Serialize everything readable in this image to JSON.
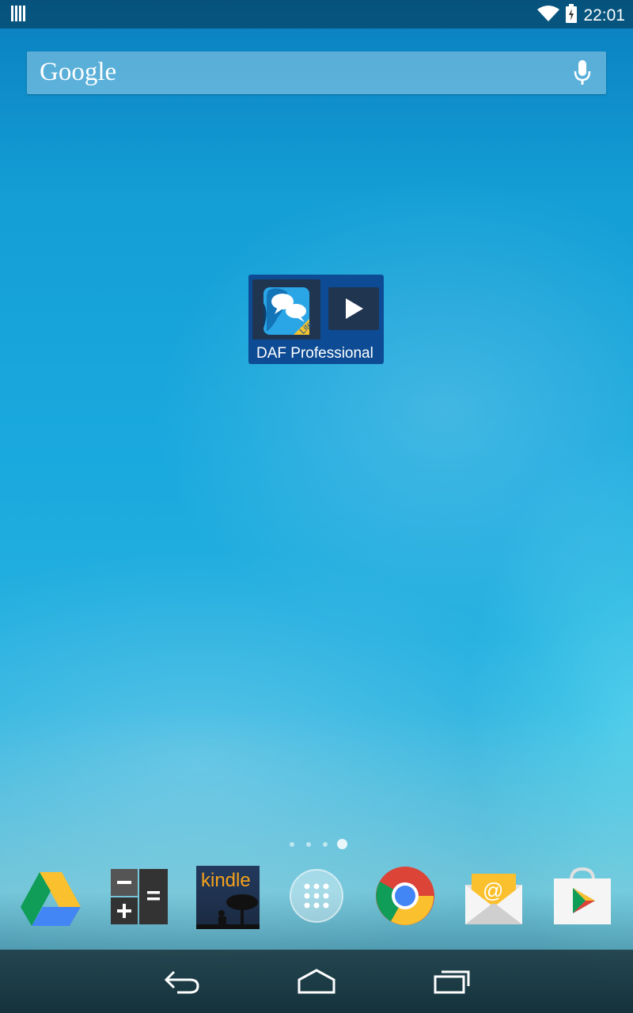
{
  "status_bar": {
    "time": "22:01",
    "icons": [
      "notification-bars-icon",
      "wifi-icon",
      "battery-icon"
    ]
  },
  "search": {
    "logo": "Google",
    "icon": "mic-icon"
  },
  "widget": {
    "label": "DAF Professional",
    "badge": "Lite",
    "icons": [
      "daf-app-icon",
      "play-icon"
    ]
  },
  "page_indicator": {
    "count": 4,
    "active": 4
  },
  "dock": {
    "apps": [
      "drive",
      "calculator",
      "kindle",
      "all-apps",
      "chrome",
      "email",
      "play-store"
    ],
    "kindle_label": "kindle"
  },
  "nav_bar": {
    "buttons": [
      "back",
      "home",
      "recents"
    ]
  },
  "colors": {
    "widget_bg": "#0d4c94",
    "status_text": "#ffffff"
  }
}
